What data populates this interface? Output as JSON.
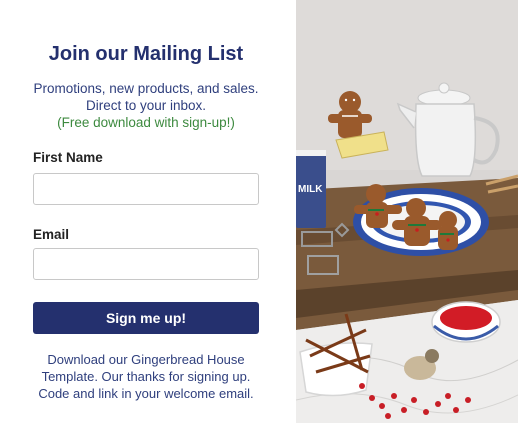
{
  "form": {
    "title": "Join our Mailing List",
    "subtitle_lines": [
      "Promotions, new products, and sales.",
      "Direct to your inbox.",
      "(Free download with sign-up!)"
    ],
    "first_name": {
      "label": "First Name",
      "value": "",
      "placeholder": ""
    },
    "email": {
      "label": "Email",
      "value": "",
      "placeholder": ""
    },
    "submit_label": "Sign me up!",
    "note_lines": [
      "Download our Gingerbread House",
      "Template. Our thanks for signing up.",
      "Code and link in your welcome email."
    ]
  },
  "photo": {
    "mug_text": "MILK"
  },
  "colors": {
    "brand_navy": "#24306e",
    "accent_green": "#3d8a3f",
    "text_navy": "#2f3f7d"
  }
}
